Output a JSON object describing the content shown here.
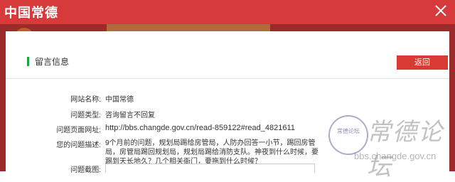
{
  "window": {
    "title": "中国常德"
  },
  "section": {
    "title": "留言信息",
    "return_label": "返回"
  },
  "fields": [
    {
      "label": "网站名称:",
      "value": "中国常德"
    },
    {
      "label": "问题类型:",
      "value": "咨询留言不回复"
    },
    {
      "label": "问题页面网址:",
      "value": "http://bbs.changde.gov.cn/read-859122#read_4821611"
    },
    {
      "label": "您的问题描述:",
      "value": "9个月前的问题，规划局踢给房管局，人防办回答一小节，踢回房管局，房管局踢回规划局，规划局踢给消防支队。神夜到什么时候，要踢到天长地久？几个相关衙门，要拖到什么时候？"
    },
    {
      "label": "问题截图:",
      "value": ""
    }
  ],
  "watermark": {
    "ring": "常德论坛",
    "text": "常德论坛",
    "url": "bbs.changde.gov.cn"
  },
  "colors": {
    "titlebar": "#d63a3a",
    "accent": "#1aa34a",
    "button": "#d83a34"
  }
}
